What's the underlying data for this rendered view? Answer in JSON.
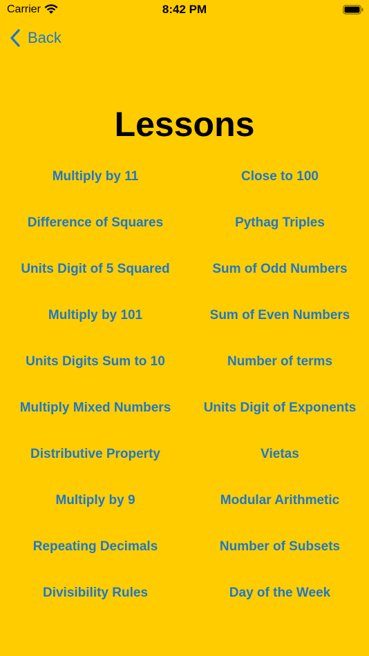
{
  "status": {
    "carrier": "Carrier",
    "time": "8:42 PM"
  },
  "nav": {
    "back_label": "Back"
  },
  "page": {
    "title": "Lessons"
  },
  "lessons": {
    "left": [
      "Multiply by 11",
      "Difference of Squares",
      "Units Digit of 5 Squared",
      "Multiply by 101",
      "Units Digits Sum to 10",
      "Multiply Mixed Numbers",
      "Distributive Property",
      "Multiply by 9",
      "Repeating Decimals",
      "Divisibility Rules"
    ],
    "right": [
      "Close to 100",
      "Pythag Triples",
      "Sum of Odd Numbers",
      "Sum of Even Numbers",
      "Number of terms",
      "Units Digit of Exponents",
      "Vietas",
      "Modular Arithmetic",
      "Number of Subsets",
      "Day of the Week"
    ]
  },
  "colors": {
    "background": "#FFCC00",
    "link": "#1E78C8",
    "text": "#000000"
  },
  "icons": {
    "wifi": "wifi-icon",
    "battery": "battery-icon",
    "back": "chevron-left-icon"
  }
}
